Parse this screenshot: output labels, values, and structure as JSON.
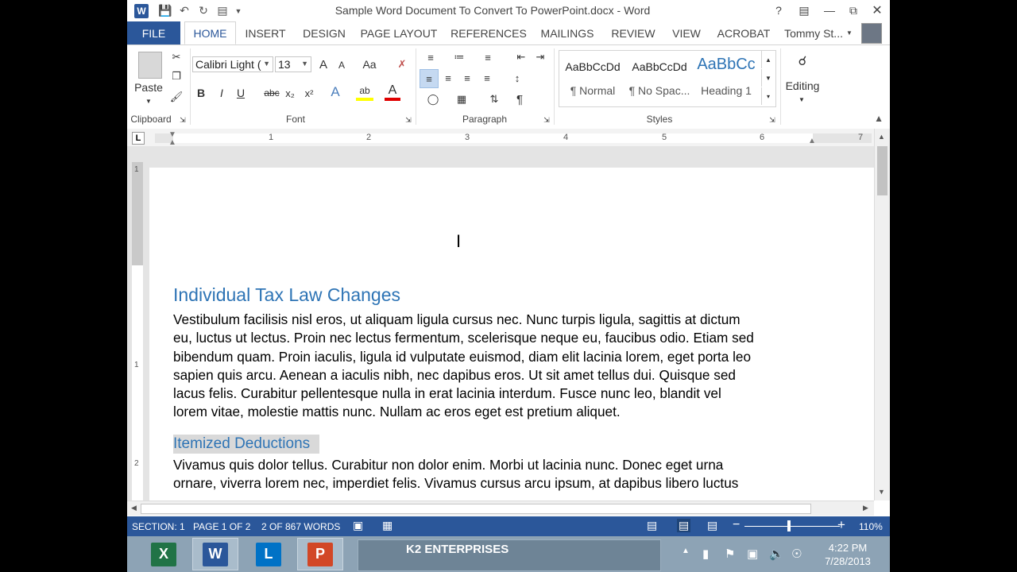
{
  "titlebar": {
    "word_logo": "W",
    "title": "Sample Word Document To Convert To PowerPoint.docx - Word",
    "help": "?",
    "icons": [
      "save-icon",
      "undo-icon",
      "redo-icon",
      "touch-mode-icon",
      "customize-icon"
    ]
  },
  "tabs": {
    "file": "FILE",
    "home": "HOME",
    "insert": "INSERT",
    "design": "DESIGN",
    "page_layout": "PAGE LAYOUT",
    "references": "REFERENCES",
    "mailings": "MAILINGS",
    "review": "REVIEW",
    "view": "VIEW",
    "acrobat": "ACROBAT",
    "user": "Tommy St..."
  },
  "ribbon": {
    "clipboard": {
      "label": "Clipboard",
      "paste": "Paste"
    },
    "font": {
      "label": "Font",
      "name": "Calibri Light (",
      "size": "13",
      "grow": "A",
      "shrink": "A",
      "case": "Aa",
      "bold": "B",
      "italic": "I",
      "underline": "U",
      "strike": "abc",
      "sub": "x₂",
      "super": "x²",
      "effects": "A",
      "highlight": "ab",
      "color": "A"
    },
    "paragraph": {
      "label": "Paragraph"
    },
    "styles": {
      "label": "Styles",
      "items": [
        {
          "sample": "AaBbCcDd",
          "name": "¶ Normal"
        },
        {
          "sample": "AaBbCcDd",
          "name": "¶ No Spac..."
        },
        {
          "sample": "AaBbCc",
          "name": "Heading 1"
        }
      ]
    },
    "editing": {
      "label": "Editing"
    }
  },
  "ruler": {
    "tab_selector": "L",
    "numbers": [
      "1",
      "2",
      "3",
      "4",
      "5",
      "6",
      "7"
    ],
    "vertical_numbers": [
      "1",
      "1",
      "2"
    ]
  },
  "document": {
    "heading1": "Individual Tax Law Changes",
    "para1_lines": [
      "Vestibulum facilisis nisl eros, ut aliquam ligula cursus nec. Nunc turpis ligula, sagittis at dictum",
      "eu, luctus ut lectus. Proin nec lectus fermentum, scelerisque neque eu, faucibus odio. Etiam sed",
      "bibendum quam. Proin iaculis, ligula id vulputate euismod, diam elit lacinia lorem, eget porta leo",
      "sapien quis arcu. Aenean a iaculis nibh, nec dapibus eros. Ut sit amet tellus dui. Quisque sed",
      "lacus felis. Curabitur pellentesque nulla in erat lacinia interdum. Fusce nunc leo, blandit vel",
      "lorem vitae, molestie mattis nunc. Nullam ac eros eget est pretium aliquet."
    ],
    "heading2": "Itemized Deductions",
    "para2_lines": [
      "Vivamus quis dolor tellus. Curabitur non dolor enim. Morbi ut lacinia nunc. Donec eget urna",
      "ornare, viverra lorem nec, imperdiet felis. Vivamus cursus arcu ipsum, at dapibus libero luctus"
    ]
  },
  "statusbar": {
    "section": "SECTION: 1",
    "page": "PAGE 1 OF 2",
    "words": "2 OF 867 WORDS",
    "zoom_minus": "−",
    "zoom_plus": "+",
    "zoom": "110%",
    "zoom_level": 0.47
  },
  "taskbar": {
    "excel": "X",
    "word": "W",
    "lync": "L",
    "powerpoint": "P",
    "banner_name": "K2 ENTERPRISES",
    "time": "4:22 PM",
    "date": "7/28/2013"
  },
  "colors": {
    "word_blue": "#2b579a",
    "heading_blue": "#2e74b5",
    "excel_green": "#217346",
    "ppt_orange": "#d24726",
    "lync_blue": "#0072c6"
  }
}
